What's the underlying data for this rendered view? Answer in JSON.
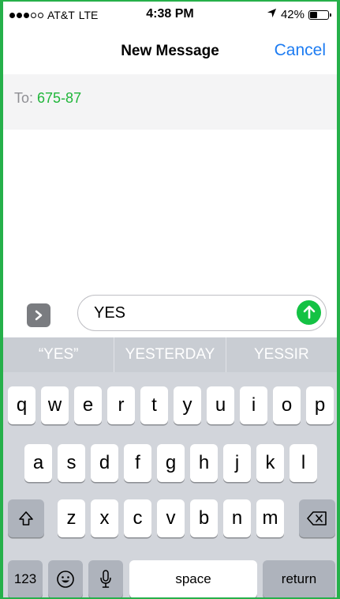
{
  "status_bar": {
    "carrier": "AT&T",
    "network": "LTE",
    "time": "4:38 PM",
    "battery_percent": "42%",
    "battery_level": 0.42,
    "signal_bars_filled": 3,
    "signal_bars_total": 5
  },
  "nav": {
    "title": "New Message",
    "cancel_label": "Cancel"
  },
  "recipient": {
    "label": "To:",
    "value": "675-87"
  },
  "compose": {
    "text": "YES"
  },
  "keyboard": {
    "predictions": [
      "“YES”",
      "YESTERDAY",
      "YESSIR"
    ],
    "row1": [
      "q",
      "w",
      "e",
      "r",
      "t",
      "y",
      "u",
      "i",
      "o",
      "p"
    ],
    "row2": [
      "a",
      "s",
      "d",
      "f",
      "g",
      "h",
      "j",
      "k",
      "l"
    ],
    "row3": [
      "z",
      "x",
      "c",
      "v",
      "b",
      "n",
      "m"
    ],
    "numbers_label": "123",
    "space_label": "space",
    "return_label": "return"
  },
  "colors": {
    "accent_blue": "#1d7cf2",
    "recipient_green": "#20b63a",
    "send_green": "#14c244",
    "frame_green": "#26b04a"
  },
  "icons": {
    "expand": "chevron-right-icon",
    "send": "arrow-up-icon",
    "shift": "shift-icon",
    "delete": "backspace-icon",
    "emoji": "emoji-icon",
    "microphone": "microphone-icon",
    "location": "location-arrow-icon"
  }
}
